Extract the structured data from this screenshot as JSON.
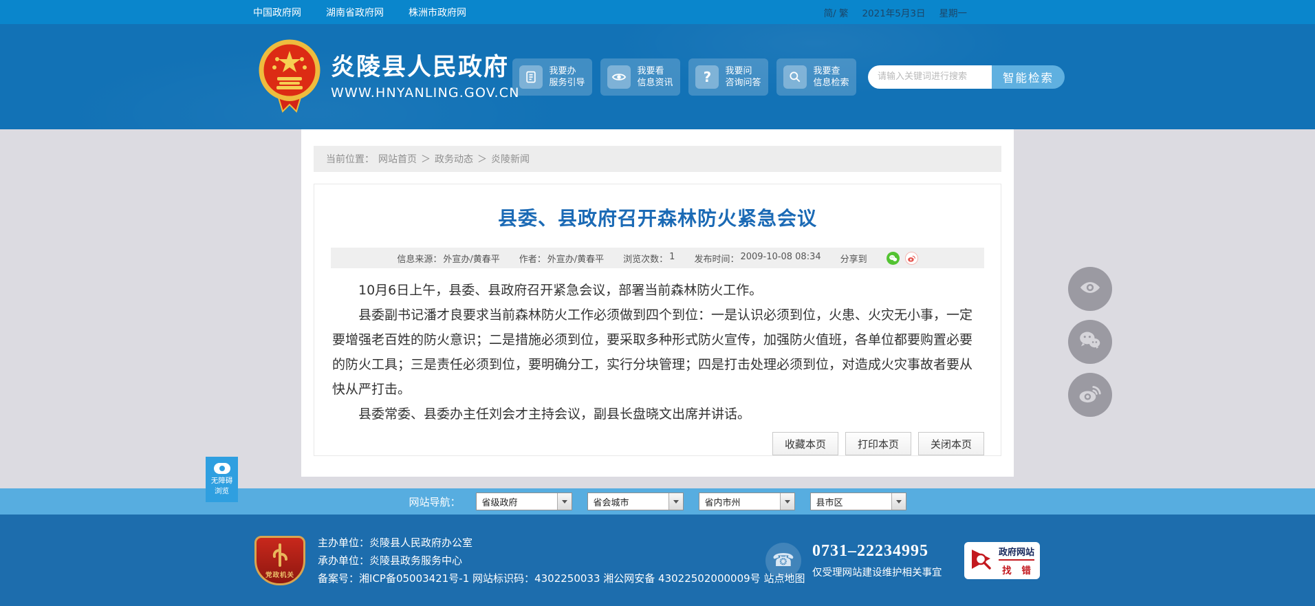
{
  "topbar": {
    "links": [
      "中国政府网",
      "湖南省政府网",
      "株洲市政府网"
    ],
    "lang": "简/ 繁",
    "date": "2021年5月3日",
    "weekday": "星期一"
  },
  "header": {
    "site_name": "炎陵县人民政府",
    "site_url": "WWW.HNYANLING.GOV.CN",
    "quick_buttons": [
      {
        "icon": "document-icon",
        "line1": "我要办",
        "line2": "服务引导"
      },
      {
        "icon": "eye-icon",
        "line1": "我要看",
        "line2": "信息资讯"
      },
      {
        "icon": "question-icon",
        "line1": "我要问",
        "line2": "咨询问答"
      },
      {
        "icon": "magnifier-icon",
        "line1": "我要查",
        "line2": "信息检索"
      }
    ],
    "search": {
      "placeholder": "请输入关键词进行搜索",
      "button": "智能检索"
    }
  },
  "breadcrumb": {
    "label": "当前位置：",
    "separator": "＞",
    "items": [
      "网站首页",
      "政务动态",
      "炎陵新闻"
    ]
  },
  "article": {
    "title": "县委、县政府召开森林防火紧急会议",
    "meta": {
      "source_label": "信息来源：",
      "source": "外宣办/黄春平",
      "author_label": "作者：",
      "author": "外宣办/黄春平",
      "views_label": "浏览次数：",
      "views": "1",
      "time_label": "发布时间：",
      "time": "2009-10-08 08:34",
      "share_label": "分享到"
    },
    "paragraphs": [
      "10月6日上午，县委、县政府召开紧急会议，部署当前森林防火工作。",
      "县委副书记潘才良要求当前森林防火工作必须做到四个到位：一是认识必须到位，火患、火灾无小事，一定要增强老百姓的防火意识；二是措施必须到位，要采取多种形式防火宣传，加强防火值班，各单位都要购置必要的防火工具；三是责任必须到位，要明确分工，实行分块管理；四是打击处理必须到位，对造成火灾事故者要从快从严打击。",
      "县委常委、县委办主任刘会才主持会议，副县长盘晓文出席并讲话。"
    ],
    "actions": [
      "收藏本页",
      "打印本页",
      "关闭本页"
    ]
  },
  "accessibility": {
    "line1": "无障碍",
    "line2": "浏览"
  },
  "sitenav": {
    "label": "网站导航：",
    "selects": [
      "省级政府",
      "省会城市",
      "省内市州",
      "县市区"
    ]
  },
  "footer": {
    "badge": "党政机关",
    "host_label": "主办单位：",
    "host": "炎陵县人民政府办公室",
    "organizer_label": "承办单位：",
    "organizer": "炎陵县政务服务中心",
    "filing_label": "备案号：",
    "icp": "湘ICP备05003421号-1",
    "code_label": "网站标识码：",
    "code": "4302250033",
    "security": "湘公网安备 43022502000009号",
    "sitemap": "站点地图",
    "phone": "0731–22234995",
    "phone_note": "仅受理网站建设维护相关事宜",
    "err_badge_top": "政府网站",
    "err_badge_bottom": "找 错"
  },
  "colors": {
    "topbar_blue": "#0a86cc",
    "header_blue": "#1272b6",
    "strip_blue": "#57ade0",
    "footer_blue": "#1d6dad",
    "title_blue": "#1b6ab5",
    "accent_red": "#c3191f",
    "wechat_green": "#53c332",
    "weibo_red": "#e6544e",
    "access_blue": "#2f9fe0"
  }
}
